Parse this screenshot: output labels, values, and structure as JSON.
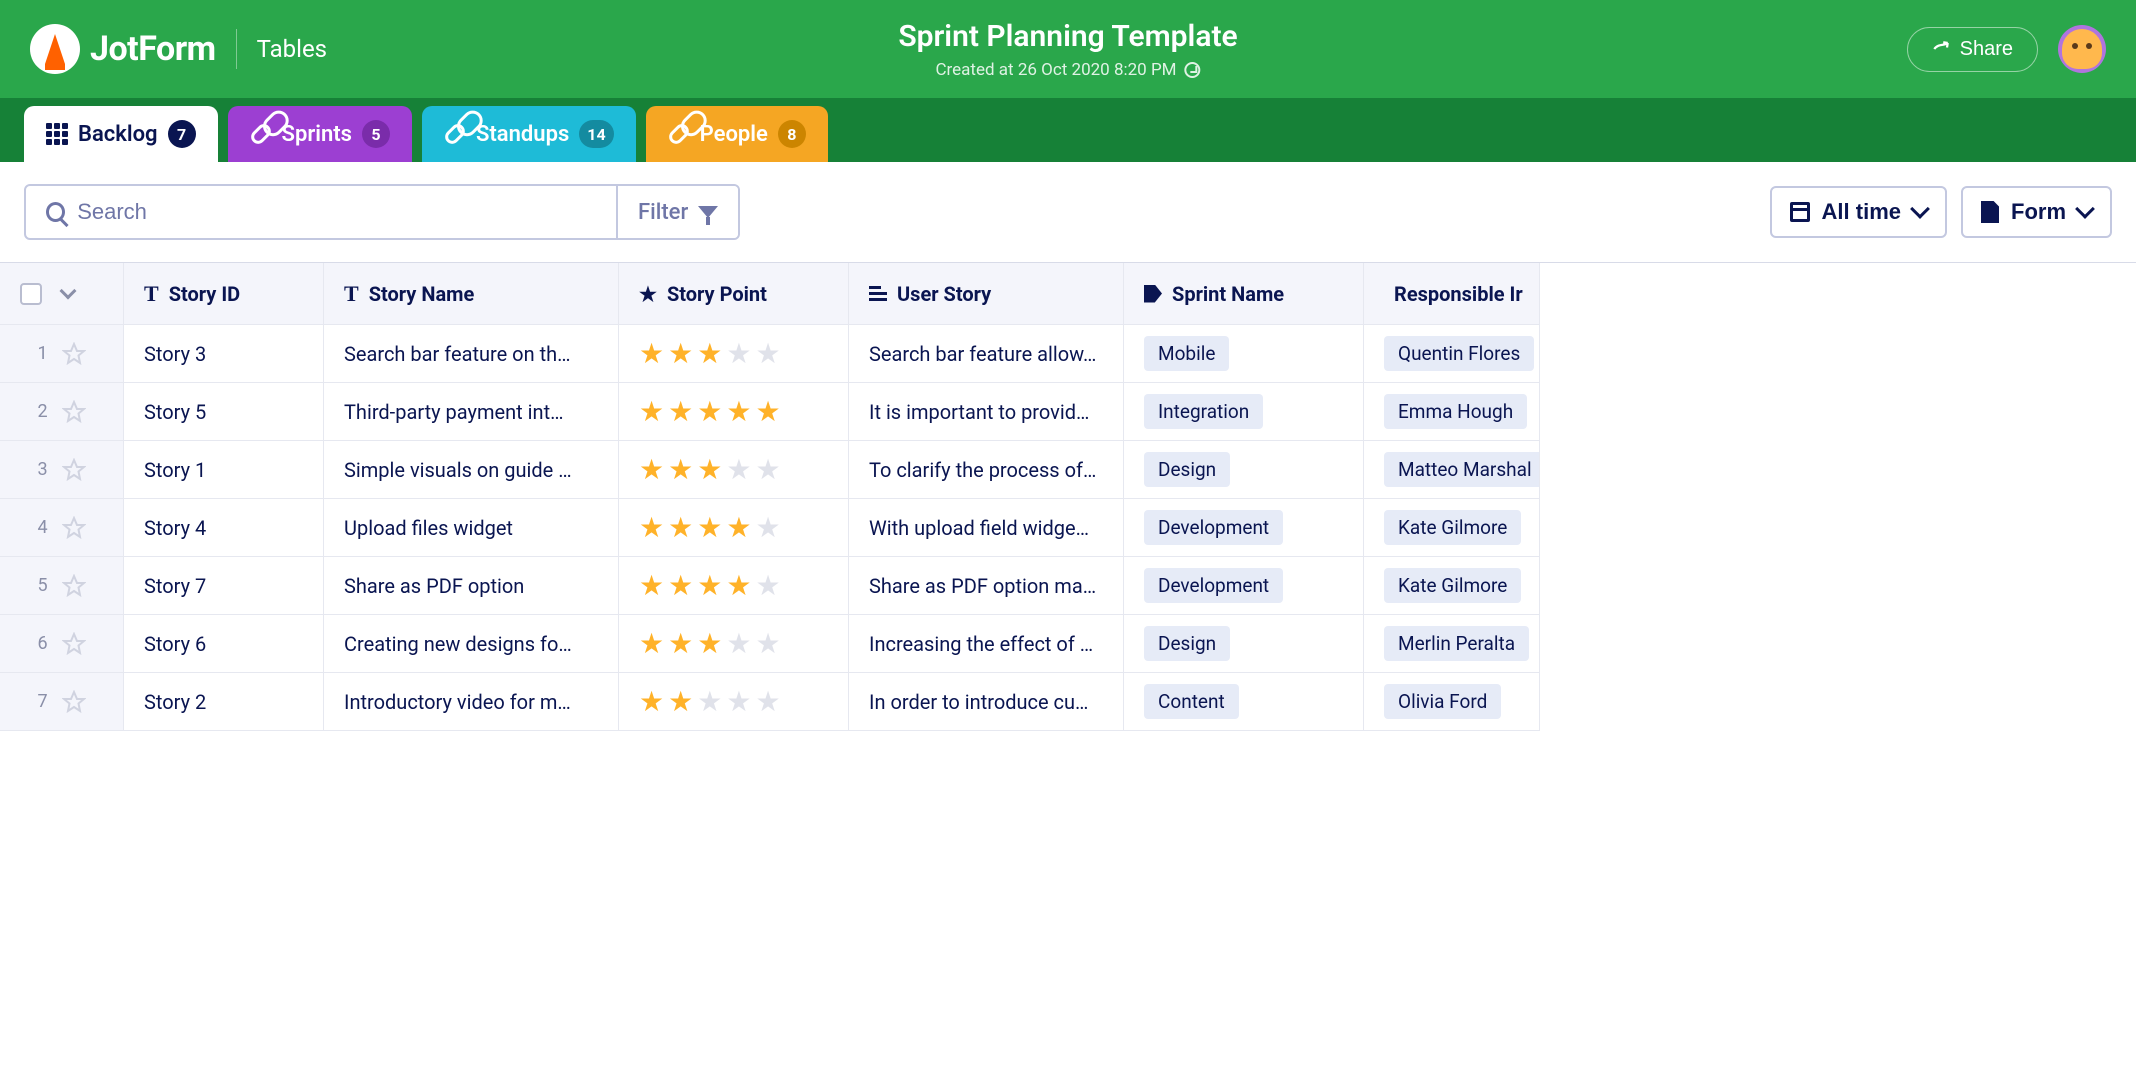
{
  "brand": {
    "name": "JotForm",
    "section": "Tables"
  },
  "page": {
    "title": "Sprint Planning Template",
    "created": "Created at 26 Oct 2020 8:20 PM"
  },
  "header": {
    "share": "Share"
  },
  "tabs": [
    {
      "label": "Backlog",
      "count": "7"
    },
    {
      "label": "Sprints",
      "count": "5"
    },
    {
      "label": "Standups",
      "count": "14"
    },
    {
      "label": "People",
      "count": "8"
    }
  ],
  "toolbar": {
    "search_placeholder": "Search",
    "filter": "Filter",
    "time_range": "All time",
    "form": "Form"
  },
  "columns": {
    "story_id": "Story ID",
    "story_name": "Story Name",
    "story_point": "Story Point",
    "user_story": "User Story",
    "sprint_name": "Sprint Name",
    "responsible": "Responsible Ir"
  },
  "rows": [
    {
      "num": "1",
      "id": "Story 3",
      "name": "Search bar feature on th…",
      "points": 3,
      "user_story": "Search bar feature allow…",
      "sprint": "Mobile",
      "resp": "Quentin Flores"
    },
    {
      "num": "2",
      "id": "Story 5",
      "name": "Third-party payment int…",
      "points": 5,
      "user_story": "It is important to provid…",
      "sprint": "Integration",
      "resp": "Emma Hough"
    },
    {
      "num": "3",
      "id": "Story 1",
      "name": "Simple visuals on guide …",
      "points": 3,
      "user_story": "To clarify the process of…",
      "sprint": "Design",
      "resp": "Matteo Marshal"
    },
    {
      "num": "4",
      "id": "Story 4",
      "name": "Upload files widget",
      "points": 4,
      "user_story": "With upload field widge…",
      "sprint": "Development",
      "resp": "Kate Gilmore"
    },
    {
      "num": "5",
      "id": "Story 7",
      "name": "Share as PDF option",
      "points": 4,
      "user_story": "Share as PDF option ma…",
      "sprint": "Development",
      "resp": "Kate Gilmore"
    },
    {
      "num": "6",
      "id": "Story 6",
      "name": "Creating new designs fo…",
      "points": 3,
      "user_story": "Increasing the effect of …",
      "sprint": "Design",
      "resp": "Merlin Peralta"
    },
    {
      "num": "7",
      "id": "Story 2",
      "name": "Introductory video for m…",
      "points": 2,
      "user_story": "In order to introduce cu…",
      "sprint": "Content",
      "resp": "Olivia Ford"
    }
  ]
}
